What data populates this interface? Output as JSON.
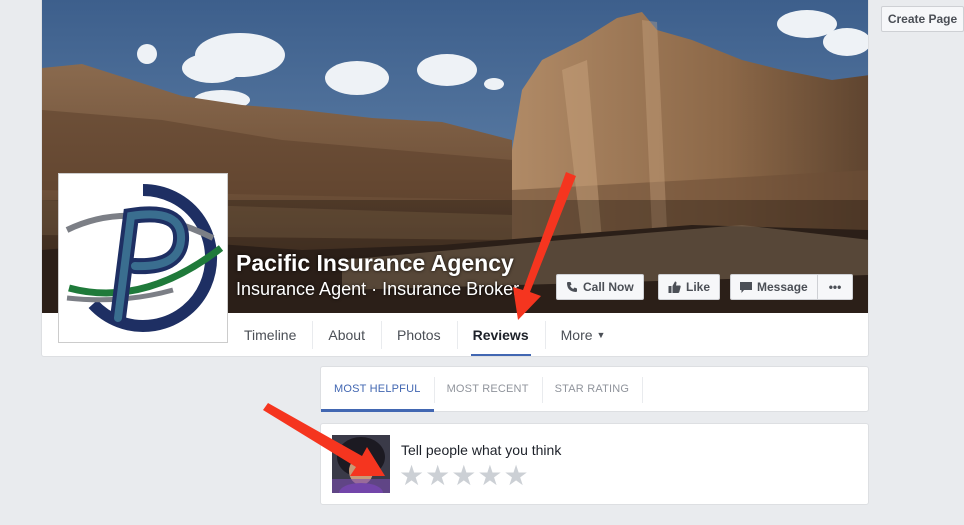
{
  "top_bar": {
    "create_page_label": "Create Page"
  },
  "page": {
    "name": "Pacific Insurance Agency",
    "categories": "Insurance Agent · Insurance Broker"
  },
  "actions": {
    "call_now": "Call Now",
    "like": "Like",
    "message": "Message",
    "more": "•••"
  },
  "tabs": [
    {
      "label": "Timeline",
      "active": false
    },
    {
      "label": "About",
      "active": false
    },
    {
      "label": "Photos",
      "active": false
    },
    {
      "label": "Reviews",
      "active": true
    },
    {
      "label": "More",
      "active": false
    }
  ],
  "review_filters": [
    {
      "label": "MOST HELPFUL",
      "active": true
    },
    {
      "label": "MOST RECENT",
      "active": false
    },
    {
      "label": "STAR RATING",
      "active": false
    }
  ],
  "composer": {
    "prompt": "Tell people what you think",
    "star_glyph": "★",
    "star_count": 5
  },
  "colors": {
    "accent": "#4267b2",
    "annotation_arrow": "#f5351f",
    "logo_navy": "#1e2f63",
    "logo_green": "#1f7a3a"
  }
}
